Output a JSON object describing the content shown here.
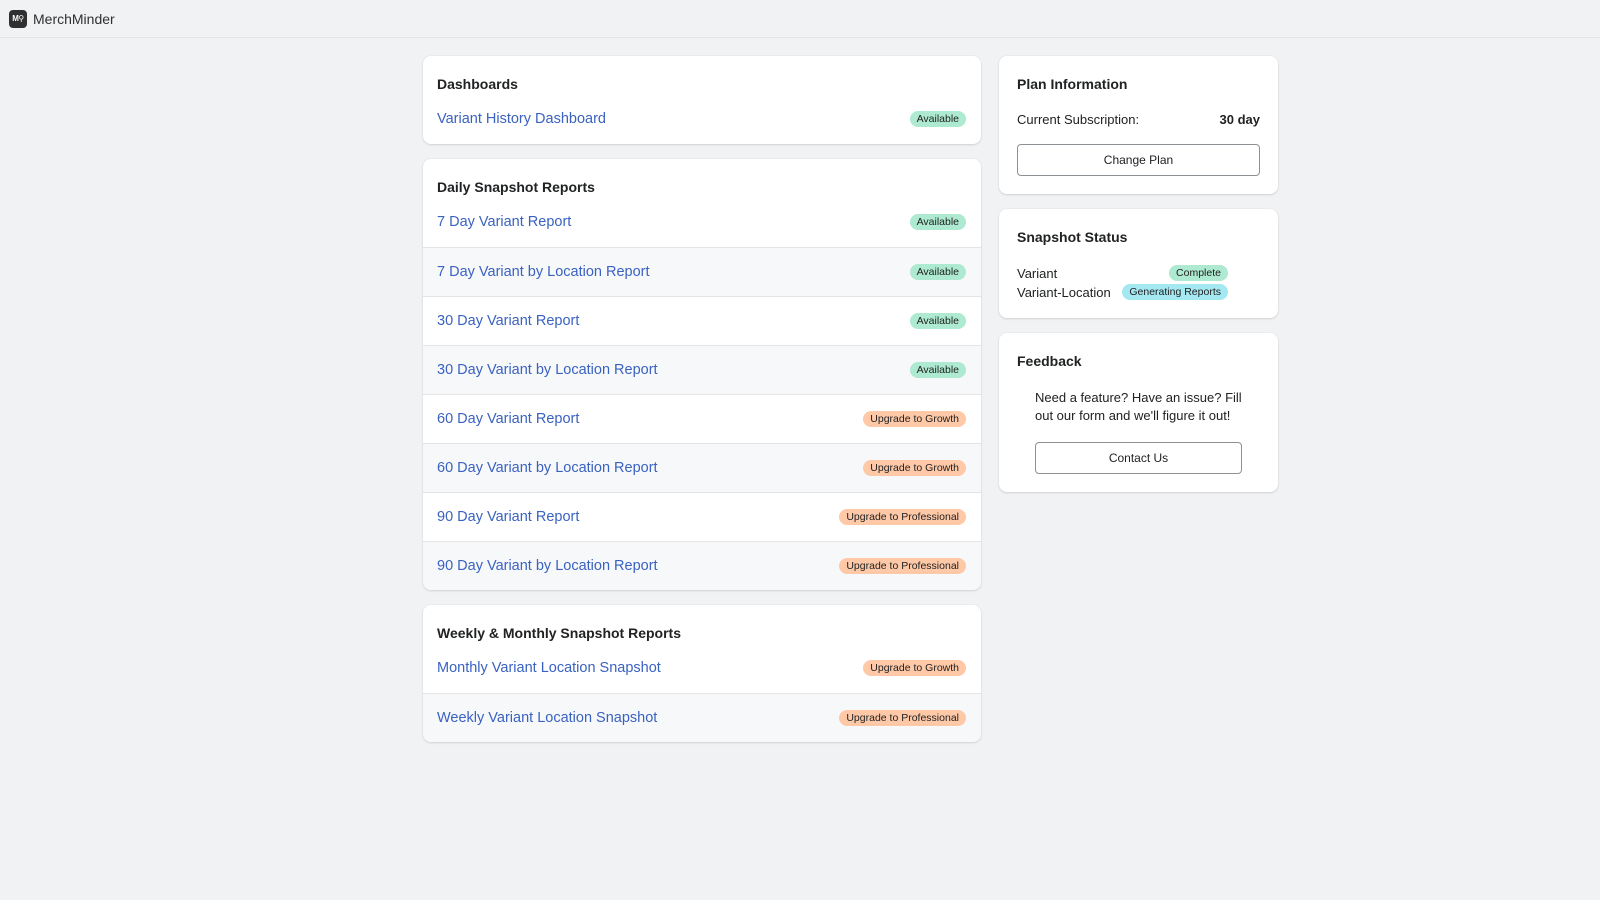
{
  "app": {
    "logo_text": "M⚲",
    "name": "MerchMinder"
  },
  "dashboards": {
    "title": "Dashboards",
    "items": [
      {
        "label": "Variant History Dashboard",
        "status": "Available",
        "status_type": "available"
      }
    ]
  },
  "daily_reports": {
    "title": "Daily Snapshot Reports",
    "items": [
      {
        "label": "7 Day Variant Report",
        "status": "Available",
        "status_type": "available"
      },
      {
        "label": "7 Day Variant by Location Report",
        "status": "Available",
        "status_type": "available"
      },
      {
        "label": "30 Day Variant Report",
        "status": "Available",
        "status_type": "available"
      },
      {
        "label": "30 Day Variant by Location Report",
        "status": "Available",
        "status_type": "available"
      },
      {
        "label": "60 Day Variant Report",
        "status": "Upgrade to Growth",
        "status_type": "upgrade"
      },
      {
        "label": "60 Day Variant by Location Report",
        "status": "Upgrade to Growth",
        "status_type": "upgrade"
      },
      {
        "label": "90 Day Variant Report",
        "status": "Upgrade to Professional",
        "status_type": "upgrade"
      },
      {
        "label": "90 Day Variant by Location Report",
        "status": "Upgrade to Professional",
        "status_type": "upgrade"
      }
    ]
  },
  "weekly_monthly_reports": {
    "title": "Weekly & Monthly Snapshot Reports",
    "items": [
      {
        "label": "Monthly Variant Location Snapshot",
        "status": "Upgrade to Growth",
        "status_type": "upgrade"
      },
      {
        "label": "Weekly Variant Location Snapshot",
        "status": "Upgrade to Professional",
        "status_type": "upgrade"
      }
    ]
  },
  "plan": {
    "title": "Plan Information",
    "subscription_label": "Current Subscription:",
    "subscription_value": "30 day",
    "change_button": "Change Plan"
  },
  "snapshot_status": {
    "title": "Snapshot Status",
    "items": [
      {
        "label": "Variant",
        "status": "Complete",
        "status_type": "available"
      },
      {
        "label": "Variant-Location",
        "status": "Generating Reports",
        "status_type": "info"
      }
    ]
  },
  "feedback": {
    "title": "Feedback",
    "text": "Need a feature? Have an issue? Fill out our form and we'll figure it out!",
    "button": "Contact Us"
  },
  "colors": {
    "link": "#3a62c0",
    "available": "#aee9d1",
    "upgrade": "#ffc8a6",
    "info": "#a4e8f2",
    "background": "#f1f2f4"
  }
}
